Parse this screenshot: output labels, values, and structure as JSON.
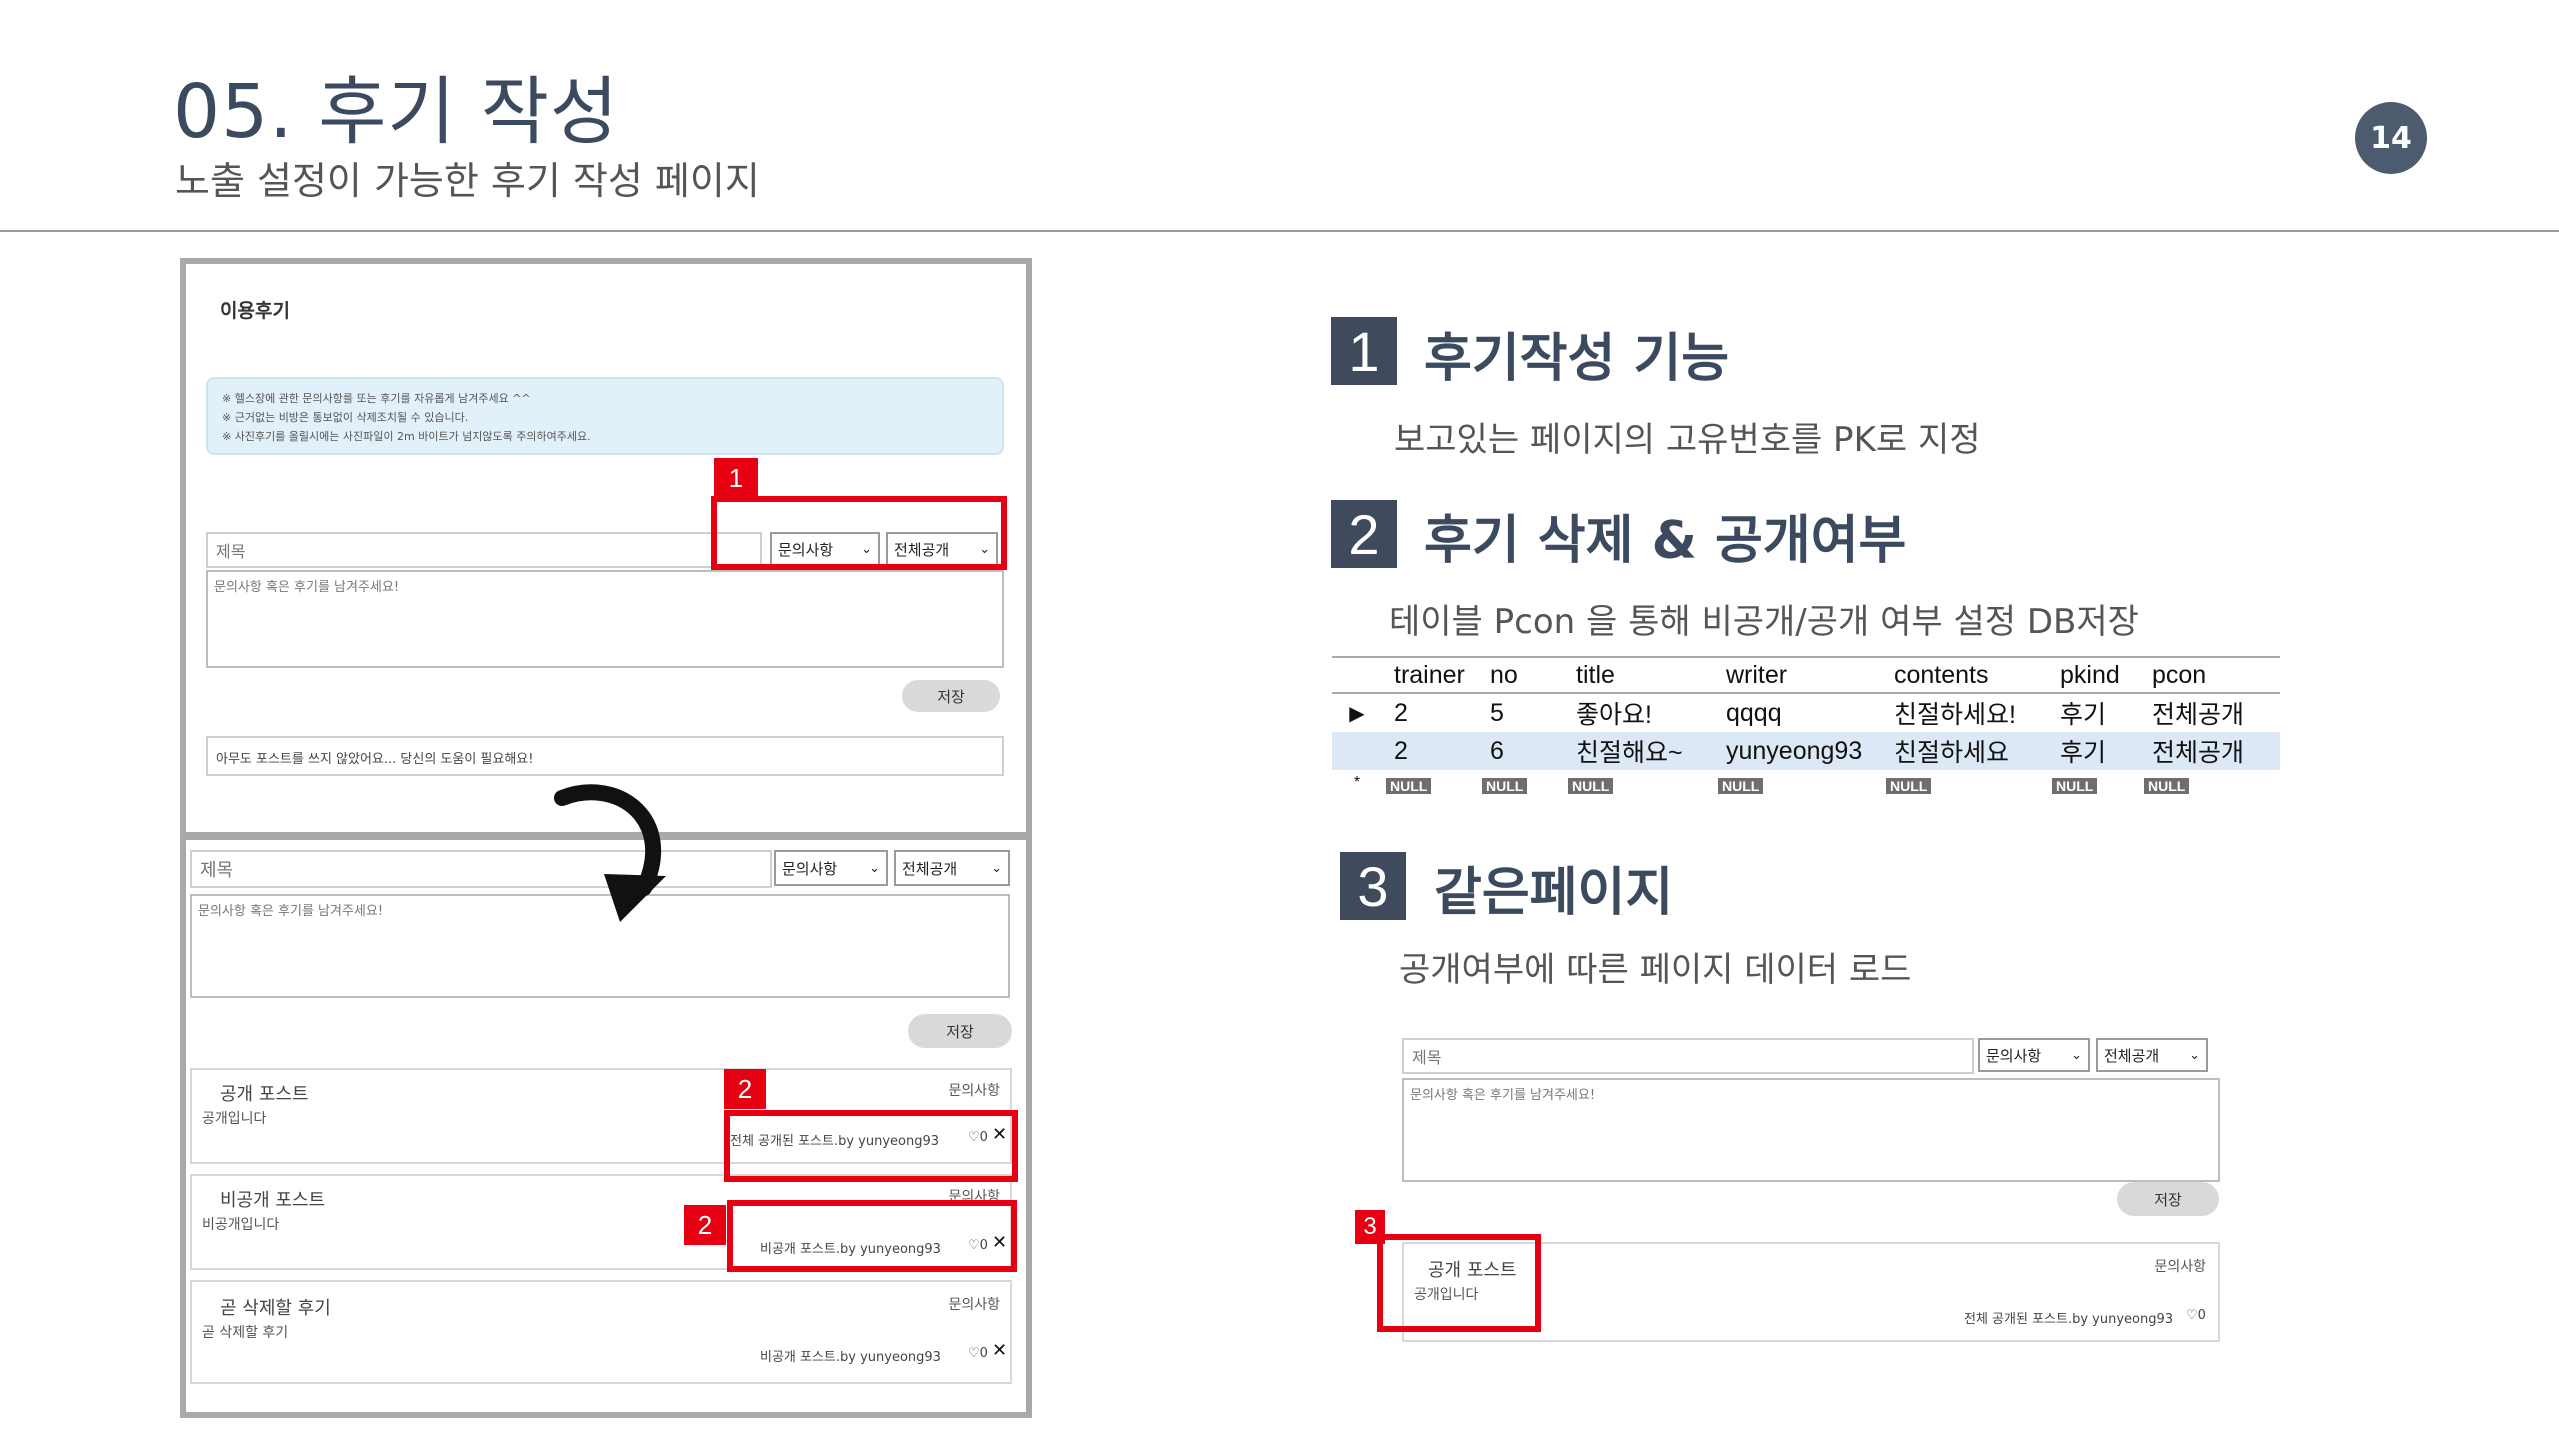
{
  "header": {
    "title": "05. 후기 작성",
    "subtitle": "노출 설정이 가능한 후기 작성 페이지",
    "page_number": "14"
  },
  "left_panel": {
    "top": {
      "heading": "이용후기",
      "notice_lines": [
        "※ 헬스장에 관한 문의사항를 또는 후기를 자유롭게 남겨주세요 ^^",
        "※ 근거없는 비방은 통보없이 삭제조치될 수 있습니다.",
        "※ 사진후기를 올릴시에는 사진파일이 2m 바이트가 넘지않도록 주의하여주세요."
      ],
      "tag": "1",
      "title_placeholder": "제목",
      "category_select": "문의사항",
      "visibility_select": "전체공개",
      "textarea_placeholder": "문의사항 혹은 후기를 남겨주세요!",
      "save_label": "저장",
      "empty_message": "아무도 포스트를 쓰지 않았어요... 당신의 도움이 필요해요!"
    },
    "bottom": {
      "title_placeholder": "제목",
      "category_select": "문의사항",
      "visibility_select": "전체공개",
      "textarea_placeholder": "문의사항 혹은 후기를 남겨주세요!",
      "save_label": "저장",
      "posts": [
        {
          "title": "공개 포스트",
          "body": "공개입니다",
          "category": "문의사항",
          "meta": "전체 공개된 포스트.by yunyeong93",
          "likes": "♡0",
          "tag": "2"
        },
        {
          "title": "비공개 포스트",
          "body": "비공개입니다",
          "category": "문의사항",
          "meta": "비공개 포스트.by yunyeong93",
          "likes": "♡0",
          "tag": "2"
        },
        {
          "title": "곧 삭제할 후기",
          "body": "곧 삭제할 후기",
          "category": "문의사항",
          "meta": "비공개 포스트.by yunyeong93",
          "likes": "♡0"
        }
      ]
    }
  },
  "sections": [
    {
      "num": "1",
      "title": "후기작성 기능",
      "desc": "보고있는 페이지의 고유번호를 PK로 지정"
    },
    {
      "num": "2",
      "title": "후기 삭제 & 공개여부",
      "desc": "테이블 Pcon 을 통해 비공개/공개 여부 설정 DB저장"
    },
    {
      "num": "3",
      "title": "같은페이지",
      "desc": "공개여부에 따른 페이지 데이터 로드"
    }
  ],
  "db_table": {
    "columns": [
      "trainer",
      "no",
      "title",
      "writer",
      "contents",
      "pkind",
      "pcon"
    ],
    "rows": [
      [
        "2",
        "5",
        "좋아요!",
        "qqqq",
        "친절하세요!",
        "후기",
        "전체공개"
      ],
      [
        "2",
        "6",
        "친절해요~",
        "yunyeong93",
        "친절하세요",
        "후기",
        "전체공개"
      ]
    ],
    "null_label": "NULL",
    "new_row_marker": "*",
    "current_row_marker": "▶"
  },
  "right_demo": {
    "tag": "3",
    "title_placeholder": "제목",
    "category_select": "문의사항",
    "visibility_select": "전체공개",
    "textarea_placeholder": "문의사항 혹은 후기를 남겨주세요!",
    "save_label": "저장",
    "post": {
      "title": "공개 포스트",
      "body": "공개입니다",
      "category": "문의사항",
      "meta": "전체 공개된 포스트.by yunyeong93",
      "likes": "♡0"
    }
  },
  "colors": {
    "accent_red": "#e60012",
    "title_navy": "#3b4a5e",
    "badge_bg": "#4d5b6e",
    "db_alt_row": "#dde8f7"
  }
}
